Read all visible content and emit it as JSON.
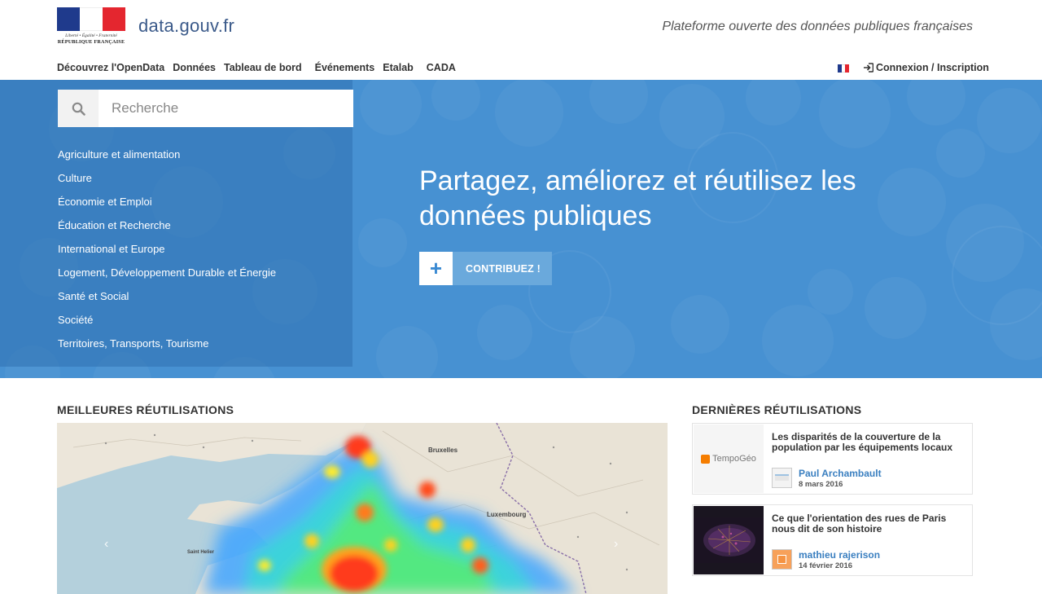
{
  "header": {
    "logo_motto": "Liberté • Égalité • Fraternité",
    "logo_republic": "RÉPUBLIQUE FRANÇAISE",
    "site_name_prefix": "data",
    "site_name_suffix": ".gouv.fr",
    "tagline": "Plateforme ouverte des données publiques françaises",
    "login_label": "Connexion / Inscription",
    "flag_colors": [
      "#1f3a8c",
      "#ffffff",
      "#e4262f"
    ]
  },
  "nav": {
    "items": [
      "Découvrez l'OpenData",
      "Données",
      "Tableau de bord",
      "Événements",
      "Etalab",
      "CADA"
    ]
  },
  "search": {
    "placeholder": "Recherche"
  },
  "topics": [
    "Agriculture et alimentation",
    "Culture",
    "Économie et Emploi",
    "Éducation et Recherche",
    "International et Europe",
    "Logement, Développement Durable et Énergie",
    "Santé et Social",
    "Société",
    "Territoires, Transports, Tourisme"
  ],
  "hero": {
    "title": "Partagez, améliorez et réutilisez les données publiques",
    "cta_label": "CONTRIBUEZ !",
    "background_color": "#4791d2"
  },
  "sections": {
    "best_reuses": "MEILLEURES RÉUTILISATIONS",
    "latest_reuses": "DERNIÈRES RÉUTILISATIONS"
  },
  "map_labels": [
    "Bruxelles",
    "Luxembourg",
    "Saint Helier"
  ],
  "latest_reuses": [
    {
      "thumb_text": "TempoGéo",
      "title": "Les disparités de la couverture de la population par les équipements locaux",
      "author": "Paul Archambault",
      "date": "8 mars 2016"
    },
    {
      "thumb_text": "",
      "title": "Ce que l'orientation des rues de Paris nous dit de son histoire",
      "author": "mathieu rajerison",
      "date": "14 février 2016"
    }
  ]
}
